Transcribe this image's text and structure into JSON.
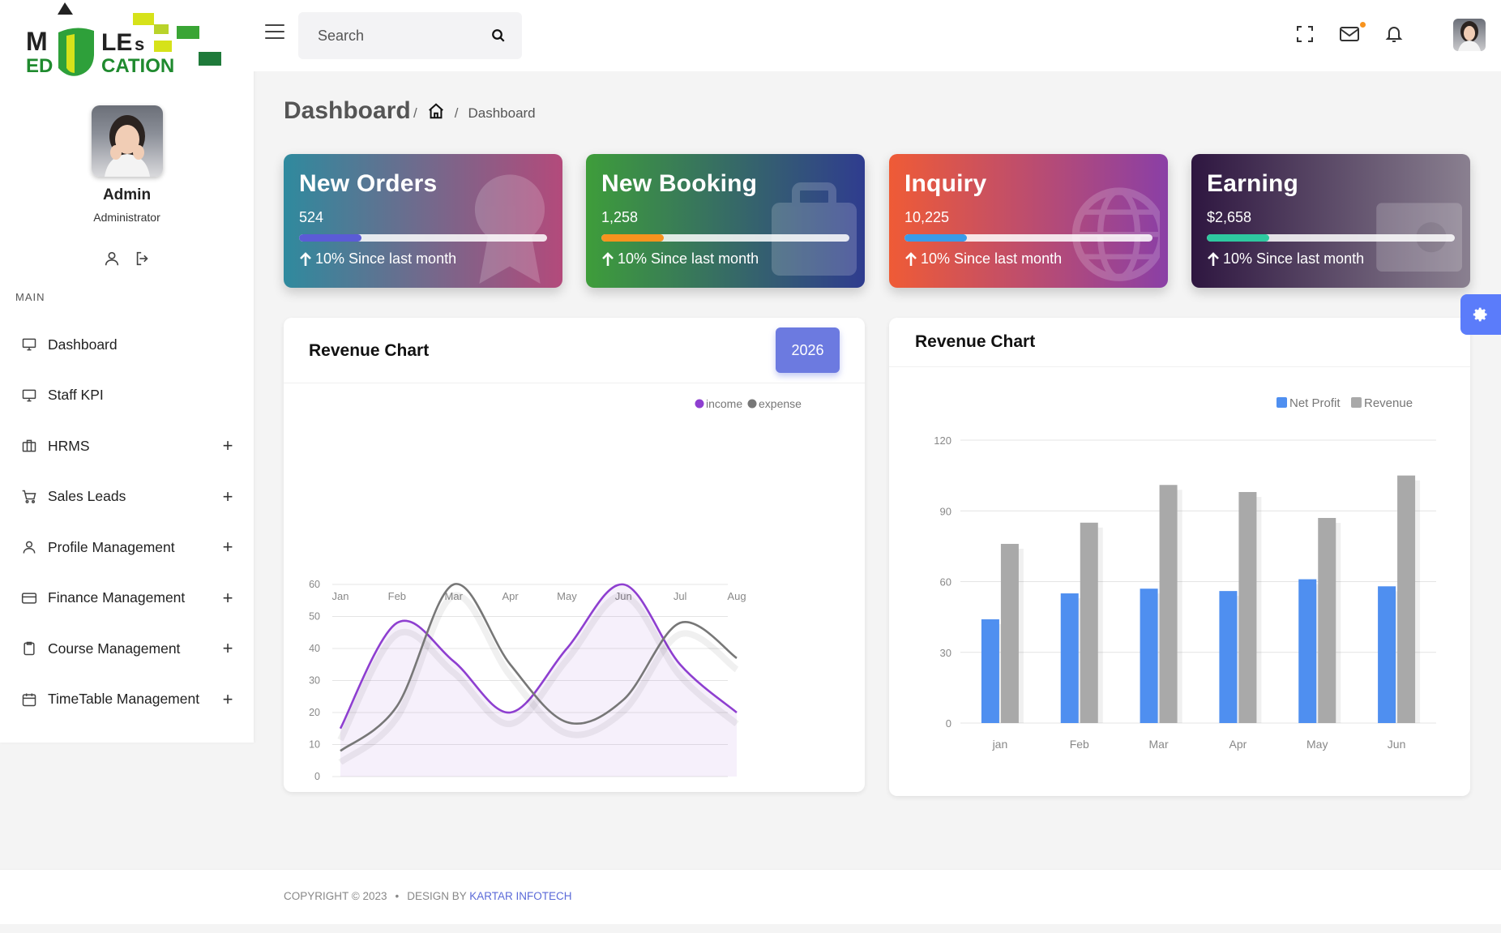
{
  "brand": {
    "logo_line1": "MULES",
    "logo_line2": "EDUCATION"
  },
  "profile": {
    "name": "Admin",
    "role": "Administrator"
  },
  "sidebar": {
    "heading": "MAIN",
    "items": [
      {
        "label": "Dashboard",
        "icon": "monitor-icon",
        "expandable": false
      },
      {
        "label": "Staff KPI",
        "icon": "monitor-icon",
        "expandable": false
      },
      {
        "label": "HRMS",
        "icon": "briefcase-icon",
        "expandable": true
      },
      {
        "label": "Sales Leads",
        "icon": "cart-icon",
        "expandable": true
      },
      {
        "label": "Profile Management",
        "icon": "user-icon",
        "expandable": true
      },
      {
        "label": "Finance Management",
        "icon": "credit-card-icon",
        "expandable": true
      },
      {
        "label": "Course Management",
        "icon": "clipboard-icon",
        "expandable": true
      },
      {
        "label": "TimeTable Management",
        "icon": "calendar-icon",
        "expandable": true
      }
    ],
    "expand_glyph": "+"
  },
  "header": {
    "search_placeholder": "Search"
  },
  "page": {
    "title": "Dashboard",
    "breadcrumb_sep": "/",
    "breadcrumb_current": "Dashboard"
  },
  "stats": [
    {
      "title": "New Orders",
      "value": "524",
      "since": "10% Since last month",
      "progress": 0.25,
      "bar_color": "#5b5bd6",
      "bg_from": "#2f8a9e",
      "bg_to": "#b34a7b"
    },
    {
      "title": "New Booking",
      "value": "1,258",
      "since": "10% Since last month",
      "progress": 0.25,
      "bar_color": "#f7931e",
      "bg_from": "#3e9d3a",
      "bg_to": "#2f3c8f"
    },
    {
      "title": "Inquiry",
      "value": "10,225",
      "since": "10% Since last month",
      "progress": 0.25,
      "bar_color": "#3a9be8",
      "bg_from": "#ef5b36",
      "bg_to": "#8a3fa6"
    },
    {
      "title": "Earning",
      "value": "$2,658",
      "since": "10% Since last month",
      "progress": 0.25,
      "bar_color": "#2ec9a0",
      "bg_from": "#2e1640",
      "bg_to": "#8a8090"
    }
  ],
  "charts": {
    "left_title": "Revenue Chart",
    "left_button": "2026",
    "right_title": "Revenue Chart"
  },
  "chart_data": [
    {
      "type": "line",
      "title": "Revenue Chart",
      "x": [
        "Jan",
        "Feb",
        "Mar",
        "Apr",
        "May",
        "Jun",
        "Jul",
        "Aug"
      ],
      "series": [
        {
          "name": "income",
          "color": "#8e3fd0",
          "values": [
            15,
            48,
            36,
            20,
            40,
            60,
            35,
            20
          ]
        },
        {
          "name": "expense",
          "color": "#777777",
          "values": [
            8,
            22,
            60,
            35,
            17,
            24,
            48,
            37
          ]
        }
      ],
      "ylim": [
        0,
        60
      ],
      "yticks": [
        0,
        10,
        20,
        30,
        40,
        50,
        60
      ],
      "legend": "top-right",
      "grid": true,
      "smooth": true
    },
    {
      "type": "bar",
      "title": "Revenue Chart",
      "categories": [
        "jan",
        "Feb",
        "Mar",
        "Apr",
        "May",
        "Jun"
      ],
      "series": [
        {
          "name": "Net Profit",
          "color": "#4f8ff0",
          "values": [
            44,
            55,
            57,
            56,
            61,
            58
          ]
        },
        {
          "name": "Revenue",
          "color": "#a9a9a9",
          "values": [
            76,
            85,
            101,
            98,
            87,
            105
          ]
        }
      ],
      "ylim": [
        0,
        120
      ],
      "yticks": [
        0,
        30,
        60,
        90,
        120
      ],
      "legend": "top-right",
      "grid": true
    }
  ],
  "footer": {
    "copyright": "COPYRIGHT © 2023",
    "dot": "•",
    "design_by": "DESIGN BY",
    "company": "KARTAR INFOTECH"
  }
}
